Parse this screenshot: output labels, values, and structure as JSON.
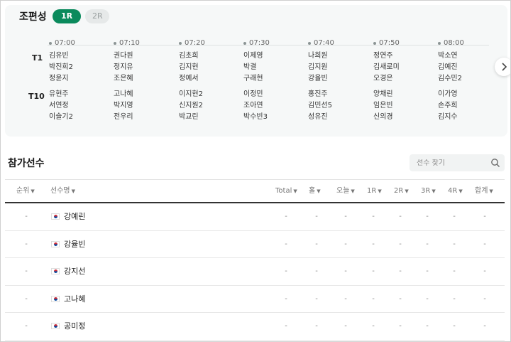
{
  "pairing": {
    "title": "조편성",
    "rounds": [
      {
        "label": "1R",
        "active": true
      },
      {
        "label": "2R",
        "active": false
      }
    ],
    "times": [
      "07:00",
      "07:10",
      "07:20",
      "07:30",
      "07:40",
      "07:50",
      "08:00"
    ],
    "tees": [
      {
        "label": "T1",
        "groups": [
          [
            "김유빈",
            "박진희2",
            "정윤지"
          ],
          [
            "권다원",
            "정지유",
            "조은혜"
          ],
          [
            "김초희",
            "김지현",
            "정예서"
          ],
          [
            "이제영",
            "박결",
            "구래현"
          ],
          [
            "나희원",
            "김지원",
            "강율빈"
          ],
          [
            "정연주",
            "김새로미",
            "오경은"
          ],
          [
            "박소연",
            "김예진",
            "김수민2"
          ]
        ]
      },
      {
        "label": "T10",
        "groups": [
          [
            "유현주",
            "서연정",
            "이슬기2"
          ],
          [
            "고나혜",
            "박지영",
            "전우리"
          ],
          [
            "이지현2",
            "신지원2",
            "박교린"
          ],
          [
            "이정민",
            "조아연",
            "박수빈3"
          ],
          [
            "홍진주",
            "김민선5",
            "성유진"
          ],
          [
            "양채린",
            "임은빈",
            "신의경"
          ],
          [
            "이가영",
            "손주희",
            "김지수"
          ]
        ]
      }
    ],
    "next_icon": "chevron-right-icon"
  },
  "participants": {
    "title": "참가선수",
    "search_placeholder": "선수 찾기",
    "search_icon": "search-icon",
    "columns": [
      "순위",
      "선수명",
      "Total",
      "홀",
      "오늘",
      "1R",
      "2R",
      "3R",
      "4R",
      "합계"
    ],
    "rows": [
      {
        "rank": "-",
        "country": "KOR",
        "name": "강예린",
        "total": "-",
        "hole": "-",
        "today": "-",
        "r1": "-",
        "r2": "-",
        "r3": "-",
        "r4": "-",
        "sum": "-"
      },
      {
        "rank": "-",
        "country": "KOR",
        "name": "강율빈",
        "total": "-",
        "hole": "-",
        "today": "-",
        "r1": "-",
        "r2": "-",
        "r3": "-",
        "r4": "-",
        "sum": "-"
      },
      {
        "rank": "-",
        "country": "KOR",
        "name": "강지선",
        "total": "-",
        "hole": "-",
        "today": "-",
        "r1": "-",
        "r2": "-",
        "r3": "-",
        "r4": "-",
        "sum": "-"
      },
      {
        "rank": "-",
        "country": "KOR",
        "name": "고나혜",
        "total": "-",
        "hole": "-",
        "today": "-",
        "r1": "-",
        "r2": "-",
        "r3": "-",
        "r4": "-",
        "sum": "-"
      },
      {
        "rank": "-",
        "country": "KOR",
        "name": "공미정",
        "total": "-",
        "hole": "-",
        "today": "-",
        "r1": "-",
        "r2": "-",
        "r3": "-",
        "r4": "-",
        "sum": "-"
      }
    ]
  },
  "colors": {
    "accent": "#0a8a5c",
    "panel_bg": "#f6f8f8"
  }
}
